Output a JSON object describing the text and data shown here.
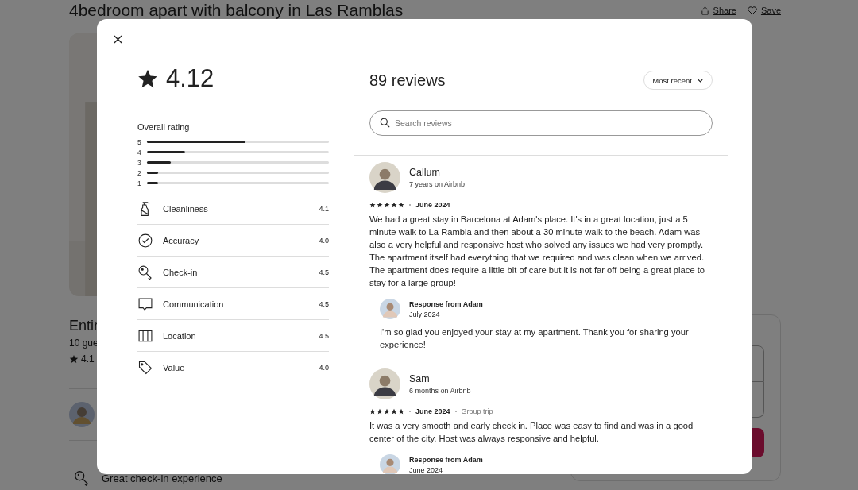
{
  "page": {
    "title": "4bedroom apart with balcony in Las Ramblas",
    "actions": [
      {
        "label": "Share",
        "kind": "share"
      },
      {
        "label": "Save",
        "kind": "save"
      }
    ],
    "listing": {
      "heading": "Entir",
      "guests": "10 gue",
      "rating": "4.1"
    },
    "highlight": {
      "title": "Great check-in experience"
    }
  },
  "modal": {
    "rating": "4.12",
    "overall_label": "Overall rating",
    "distribution": [
      {
        "label": "5",
        "level": 0.54
      },
      {
        "label": "4",
        "level": 0.21
      },
      {
        "label": "3",
        "level": 0.13
      },
      {
        "label": "2",
        "level": 0.06
      },
      {
        "label": "1",
        "level": 0.06
      }
    ],
    "categories": [
      {
        "label": "Cleanliness",
        "score": "4.1",
        "kind": "cleanliness"
      },
      {
        "label": "Accuracy",
        "score": "4.0",
        "kind": "accuracy"
      },
      {
        "label": "Check-in",
        "score": "4.5",
        "kind": "checkin"
      },
      {
        "label": "Communication",
        "score": "4.5",
        "kind": "communication"
      },
      {
        "label": "Location",
        "score": "4.5",
        "kind": "location"
      },
      {
        "label": "Value",
        "score": "4.0",
        "kind": "value"
      }
    ],
    "reviews_title": "89 reviews",
    "sort": "Most recent",
    "search": {
      "placeholder": "Search reviews"
    },
    "reviews": [
      {
        "name": "Callum",
        "tenure": "7 years on Airbnb",
        "stars": 5,
        "date": "June 2024",
        "text": "We had a great stay in Barcelona at Adam's place. It's in a great location, just a 5 minute walk to La Rambla and then about a 30 minute walk to the beach. Adam was also a very helpful and responsive host who solved any issues we had very promptly. The apartment itself had everything that we required and was clean when we arrived. The apartment does require a little bit of care but it is not far off being a great place to stay for a large group!",
        "response": {
          "from": "Response from Adam",
          "date": "July 2024",
          "text": "I'm so glad you enjoyed your stay at my apartment. Thank you for sharing your experience!"
        }
      },
      {
        "name": "Sam",
        "tenure": "6 months on Airbnb",
        "stars": 5,
        "date": "June 2024",
        "trip": "Group trip",
        "text": "It was a very smooth and early check in. Place was easy to find and was in a good center of the city. Host was always responsive and helpful.",
        "response": {
          "from": "Response from Adam",
          "date": "June 2024"
        }
      }
    ]
  }
}
